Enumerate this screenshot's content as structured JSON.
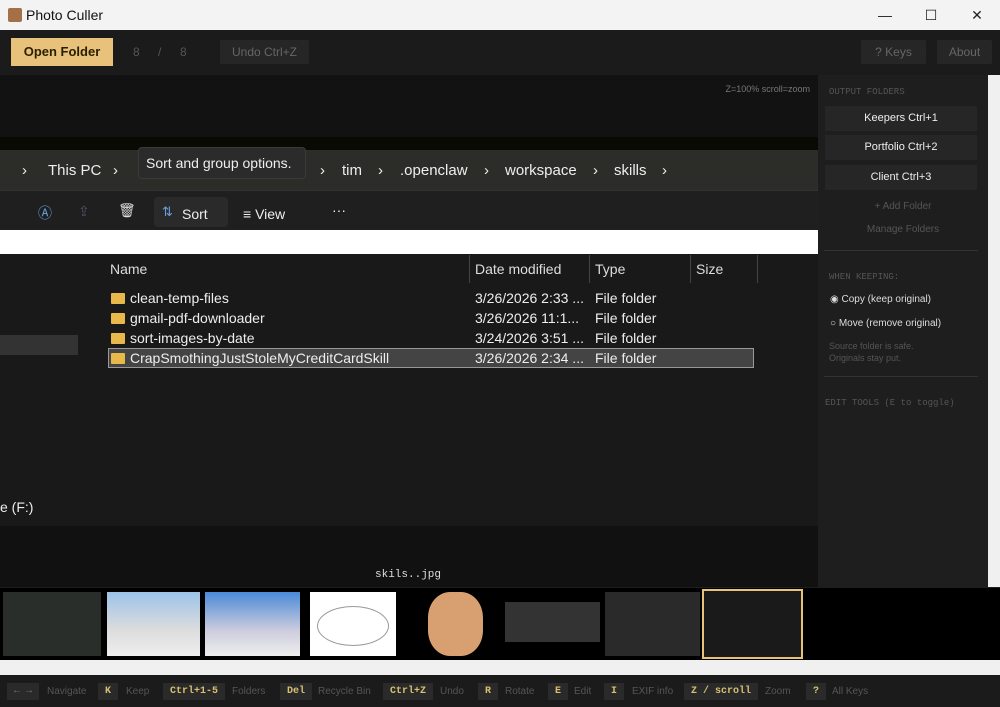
{
  "window": {
    "title": "Photo Culler",
    "minimize": "—",
    "maximize": "☐",
    "close": "✕"
  },
  "toolbar": {
    "open_folder": "Open Folder",
    "counter_current": "8",
    "counter_sep": "/",
    "counter_total": "8",
    "undo": "Undo  Ctrl+Z",
    "keys": "?  Keys",
    "about": "About"
  },
  "viewer": {
    "zoom_info": "Z=100%  scroll=zoom",
    "filename": "skils..jpg"
  },
  "explorer": {
    "breadcrumbs": [
      "This PC",
      "tim",
      ".openclaw",
      "workspace",
      "skills"
    ],
    "tooltip": "Sort and group options.",
    "toolbar": {
      "sort": "Sort",
      "view": "View",
      "more": "···"
    },
    "columns": [
      "Name",
      "Date modified",
      "Type",
      "Size"
    ],
    "rows": [
      {
        "name": "clean-temp-files",
        "date": "3/26/2026 2:33 ...",
        "type": "File folder"
      },
      {
        "name": "gmail-pdf-downloader",
        "date": "3/26/2026 11:1...",
        "type": "File folder"
      },
      {
        "name": "sort-images-by-date",
        "date": "3/24/2026 3:51 ...",
        "type": "File folder"
      },
      {
        "name": "CrapSmothingJustStoleMyCreditCardSkill",
        "date": "3/26/2026 2:34 ...",
        "type": "File folder"
      }
    ],
    "nav_drive": "e (F:)"
  },
  "panel": {
    "output_heading": "OUTPUT FOLDERS",
    "folders": [
      "Keepers  Ctrl+1",
      "Portfolio  Ctrl+2",
      "Client  Ctrl+3"
    ],
    "add_folder": "+ Add Folder",
    "manage": "Manage Folders",
    "keeping_heading": "WHEN KEEPING:",
    "copy": "Copy  (keep original)",
    "move": "Move  (remove original)",
    "note1": "Source folder is safe.",
    "note2": "Originals stay put.",
    "edit_heading": "EDIT TOOLS   (E to toggle)"
  },
  "shortcuts": [
    {
      "key": "← →",
      "label": "Navigate"
    },
    {
      "key": "K",
      "label": "Keep"
    },
    {
      "key": "Ctrl+1-5",
      "label": "Folders"
    },
    {
      "key": "Del",
      "label": "Recycle Bin"
    },
    {
      "key": "Ctrl+Z",
      "label": "Undo"
    },
    {
      "key": "R",
      "label": "Rotate"
    },
    {
      "key": "E",
      "label": "Edit"
    },
    {
      "key": "I",
      "label": "EXIF info"
    },
    {
      "key": "Z / scroll",
      "label": "Zoom"
    },
    {
      "key": "?",
      "label": "All Keys"
    }
  ],
  "colors": {
    "accent": "#e8c27a"
  }
}
